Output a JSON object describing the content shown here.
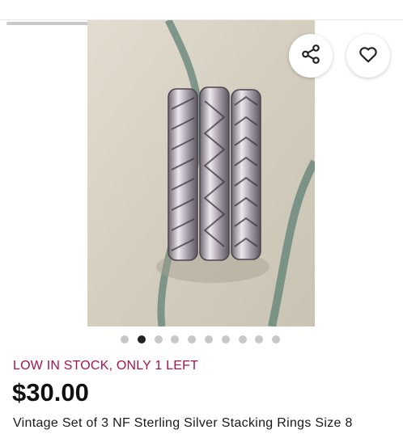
{
  "listing": {
    "stock_status": "LOW IN STOCK, ONLY 1 LEFT",
    "price": "$30.00",
    "title": "Vintage Set of 3 NF Sterling Silver Stacking Rings Size 8"
  },
  "gallery": {
    "image_count": 10,
    "active_index": 1
  },
  "actions": {
    "share_icon": "share-icon",
    "favorite_icon": "heart-icon"
  },
  "colors": {
    "stock_accent": "#a3144d",
    "active_dot": "#222222",
    "inactive_dot": "#c7c7c7"
  }
}
